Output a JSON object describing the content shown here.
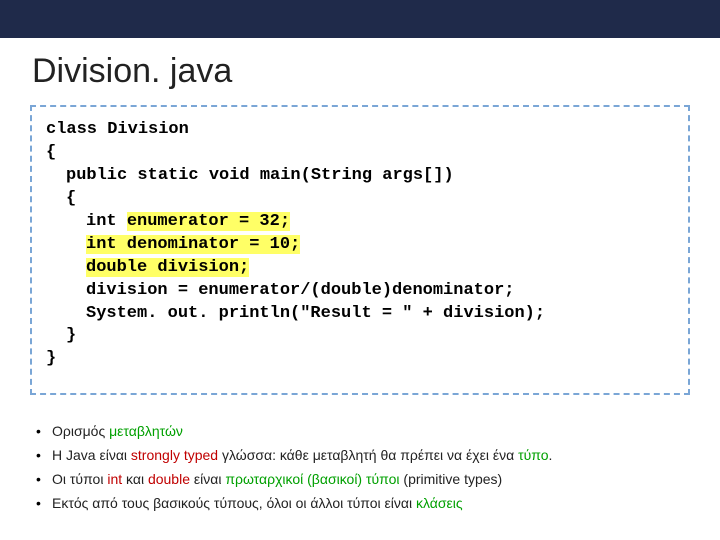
{
  "title": "Division. java",
  "code": {
    "l1": "class Division",
    "l2": "{",
    "l3": "public static void main(String args[])",
    "l4": "{",
    "l5a": "int ",
    "l5b": "enumerator = 32;",
    "l6": "int denominator = 10;",
    "l7": "double division;",
    "l8": "division = enumerator/(double)denominator;",
    "l9": "System. out. println(\"Result = \" + division);",
    "l10": "}",
    "l11": "}"
  },
  "bullets": {
    "b1a": "Ορισμός ",
    "b1b": "μεταβλητών",
    "b2a": "Η Java είναι ",
    "b2b": "strongly typed",
    "b2c": " γλώσσα: κάθε μεταβλητή θα πρέπει να έχει ένα ",
    "b2d": "τύπο",
    "b2e": ".",
    "b3a": "Οι τύποι ",
    "b3b": "int",
    "b3c": " και ",
    "b3d": "double",
    "b3e": " είναι ",
    "b3f": "πρωταρχικοί (βασικοί) τύποι",
    "b3g": " (primitive types)",
    "b4a": "Εκτός από τους βασικούς τύπους, όλοι οι άλλοι τύποι είναι ",
    "b4b": "κλάσεις"
  }
}
